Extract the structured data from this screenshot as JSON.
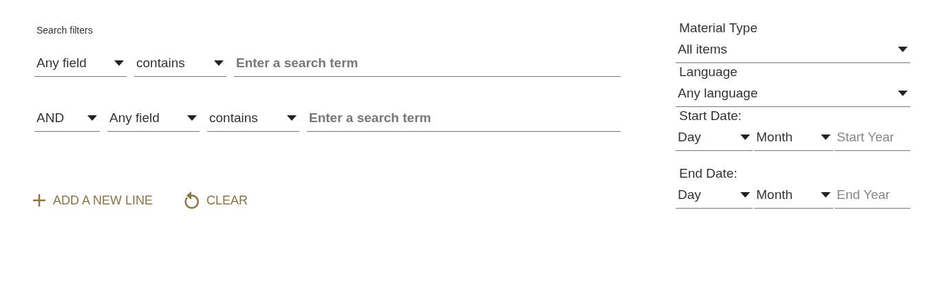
{
  "search_filters": {
    "label": "Search filters",
    "rows": [
      {
        "fields": [
          {
            "kind": "select",
            "value": "Any field"
          },
          {
            "kind": "select",
            "value": "contains"
          },
          {
            "kind": "text",
            "placeholder": "Enter a search term"
          }
        ]
      },
      {
        "fields": [
          {
            "kind": "operator",
            "value": "AND"
          },
          {
            "kind": "select",
            "value": "Any field"
          },
          {
            "kind": "select",
            "value": "contains"
          },
          {
            "kind": "text",
            "placeholder": "Enter a search term"
          }
        ]
      }
    ]
  },
  "actions": [
    {
      "kind": "add",
      "label": "ADD A NEW LINE"
    },
    {
      "kind": "clear",
      "label": "CLEAR"
    }
  ],
  "sidebar": {
    "material_type": {
      "label": "Material Type",
      "value": "All items"
    },
    "language": {
      "label": "Language",
      "value": "Any language"
    },
    "start_date": {
      "label": "Start Date:",
      "day": "Day",
      "month": "Month",
      "year_placeholder": "Start Year"
    },
    "end_date": {
      "label": "End Date:",
      "day": "Day",
      "month": "Month",
      "year_placeholder": "End Year"
    }
  }
}
